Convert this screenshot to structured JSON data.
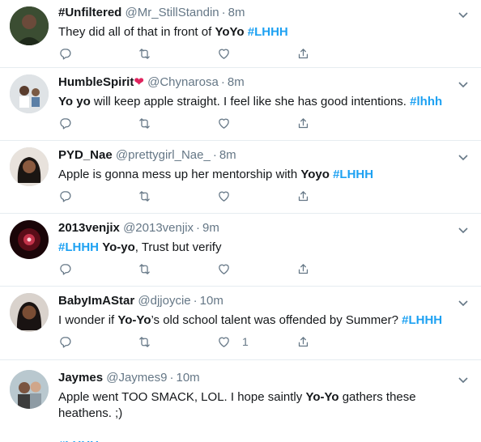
{
  "colors": {
    "accent": "#1da1f2",
    "secondary": "#657786",
    "heart": "#e0245e",
    "divider": "#e6ecf0"
  },
  "tweets": [
    {
      "name": "#Unfiltered",
      "name_suffix": "",
      "handle": "@Mr_StillStandin",
      "dot": "·",
      "time": "8m",
      "text": [
        {
          "t": "They did all of that in front of "
        },
        {
          "t": "YoYo",
          "b": true
        },
        {
          "t": " "
        },
        {
          "t": "#LHHH",
          "h": true
        }
      ],
      "like_count": ""
    },
    {
      "name": "HumbleSpirit",
      "name_suffix": "❤",
      "handle": "@Chynarosa",
      "dot": "·",
      "time": "8m",
      "text": [
        {
          "t": "Yo yo",
          "b": true
        },
        {
          "t": " will keep apple straight. I feel like she has good intentions.  "
        },
        {
          "t": "#lhhh",
          "h": true
        }
      ],
      "like_count": ""
    },
    {
      "name": "PYD_Nae",
      "name_suffix": "",
      "handle": "@prettygirl_Nae_",
      "dot": "·",
      "time": "8m",
      "text": [
        {
          "t": "Apple is gonna mess up her mentorship with "
        },
        {
          "t": "Yoyo",
          "b": true
        },
        {
          "t": " "
        },
        {
          "t": "#LHHH",
          "h": true
        }
      ],
      "like_count": ""
    },
    {
      "name": "2013venjix",
      "name_suffix": "",
      "handle": "@2013venjix",
      "dot": "·",
      "time": "9m",
      "text": [
        {
          "t": "#LHHH",
          "h": true
        },
        {
          "t": " "
        },
        {
          "t": "Yo-yo",
          "b": true
        },
        {
          "t": ", Trust but verify"
        }
      ],
      "like_count": ""
    },
    {
      "name": "BabyImAStar",
      "name_suffix": "",
      "handle": "@djjoycie",
      "dot": "·",
      "time": "10m",
      "text": [
        {
          "t": "I wonder if "
        },
        {
          "t": "Yo-Yo",
          "b": true
        },
        {
          "t": "’s old school talent was offended by Summer? "
        },
        {
          "t": "#LHHH",
          "h": true
        }
      ],
      "like_count": "1"
    },
    {
      "name": "Jaymes",
      "name_suffix": "",
      "handle": "@Jaymes9",
      "dot": "·",
      "time": "10m",
      "text": [
        {
          "t": "Apple went TOO SMACK, LOL.  I hope saintly "
        },
        {
          "t": "Yo-Yo",
          "b": true
        },
        {
          "t": " gathers these heathens. ;)"
        },
        {
          "t": "\n\n"
        },
        {
          "t": "#LHHH",
          "h": true
        }
      ],
      "like_count": ""
    }
  ],
  "icons": {
    "reply": "reply-icon",
    "retweet": "retweet-icon",
    "like": "heart-icon",
    "share": "share-icon",
    "menu": "chevron-down-icon"
  }
}
